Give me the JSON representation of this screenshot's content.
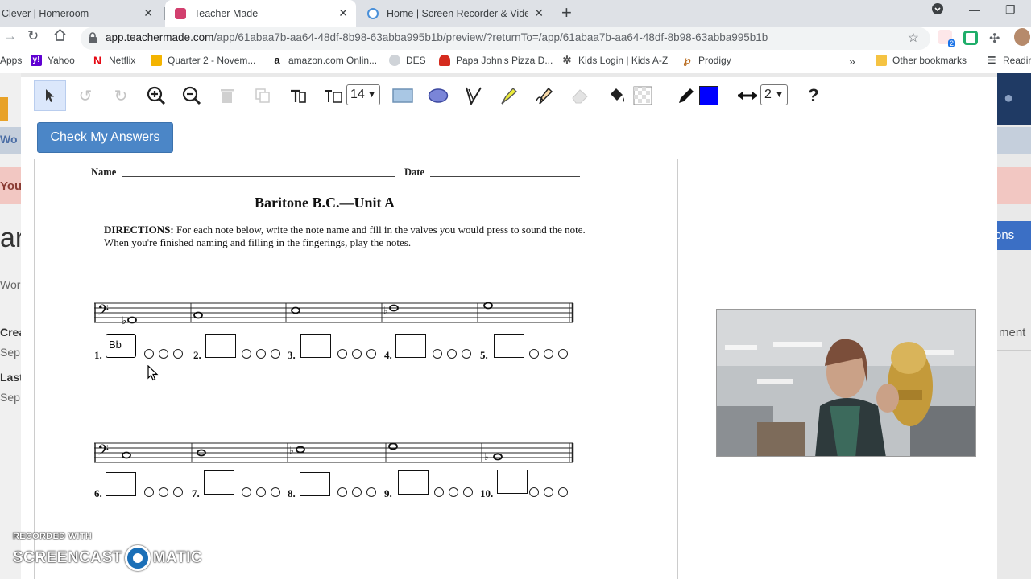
{
  "browser": {
    "tabs": [
      {
        "title": "Clever | Homeroom",
        "active": false
      },
      {
        "title": "Teacher Made",
        "active": true
      },
      {
        "title": "Home | Screen Recorder & Video",
        "active": false
      }
    ],
    "url_host": "app.teachermade.com",
    "url_path": "/app/61abaa7b-aa64-48df-8b98-63abba995b1b/preview/?returnTo=/app/61abaa7b-aa64-48df-8b98-63abba995b1b",
    "extension_badge": "2",
    "bookmarks": [
      {
        "label": "Apps",
        "icon": "apps-grid-icon"
      },
      {
        "label": "Yahoo",
        "icon": "yahoo-icon",
        "color": "#6001d2"
      },
      {
        "label": "Netflix",
        "icon": "netflix-icon",
        "color": "#e50914"
      },
      {
        "label": "Quarter 2 - Novem...",
        "icon": "classroom-icon",
        "color": "#f4b400"
      },
      {
        "label": "amazon.com Onlin...",
        "icon": "amazon-icon"
      },
      {
        "label": "DES",
        "icon": "des-icon"
      },
      {
        "label": "Papa John's Pizza D...",
        "icon": "papa-johns-icon",
        "color": "#d52b1e"
      },
      {
        "label": "Kids Login | Kids A-Z",
        "icon": "kids-az-icon"
      },
      {
        "label": "Prodigy",
        "icon": "prodigy-icon"
      },
      {
        "label": "Other bookmarks",
        "icon": "folder-icon"
      },
      {
        "label": "Readin",
        "icon": "reading-list-icon"
      }
    ]
  },
  "background_app": {
    "texts": [
      "Wo",
      "You",
      "ar",
      "Wor",
      "Crea",
      "Sep",
      "Last",
      "Sep",
      "ment",
      "ctions"
    ]
  },
  "editor": {
    "font_size": "14",
    "line_width": "2",
    "fill_color": "#0000ff",
    "help_label": "?",
    "check_button": "Check My Answers"
  },
  "worksheet": {
    "name_label": "Name",
    "date_label": "Date",
    "title": "Baritone B.C.—Unit A",
    "directions_lead": "DIRECTIONS:",
    "directions_text": " For each note below, write the note name and fill in the valves you would press to sound the note. When you're finished naming and filling in the fingerings, play the notes.",
    "row1": [
      {
        "num": "1.",
        "answer": "Bb"
      },
      {
        "num": "2.",
        "answer": ""
      },
      {
        "num": "3.",
        "answer": ""
      },
      {
        "num": "4.",
        "answer": ""
      },
      {
        "num": "5.",
        "answer": ""
      }
    ],
    "row2": [
      {
        "num": "6.",
        "answer": ""
      },
      {
        "num": "7.",
        "answer": ""
      },
      {
        "num": "8.",
        "answer": ""
      },
      {
        "num": "9.",
        "answer": ""
      },
      {
        "num": "10.",
        "answer": ""
      }
    ]
  },
  "watermark": {
    "line1": "RECORDED WITH",
    "line2a": "SCREENCAST",
    "line2b": "MATIC"
  }
}
